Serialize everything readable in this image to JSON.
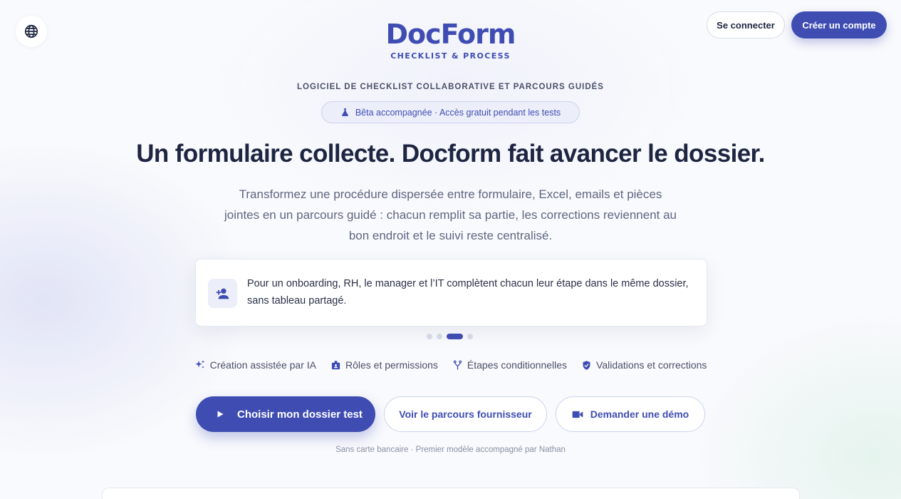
{
  "header": {
    "logo": {
      "name": "DocForm",
      "tagline": "CHECKLIST & PROCESS"
    },
    "login_label": "Se connecter",
    "signup_label": "Créer un compte",
    "globe_icon": "globe-icon"
  },
  "hero": {
    "eyebrow": "LOGICIEL DE CHECKLIST COLLABORATIVE ET PARCOURS GUIDÉS",
    "badge": {
      "icon": "flask-icon",
      "text": "Bêta accompagnée · Accès gratuit pendant les tests"
    },
    "headline": "Un formulaire collecte. Docform fait avancer le dossier.",
    "lead": "Transformez une procédure dispersée entre formulaire, Excel, emails et pièces jointes en un parcours guidé : chacun remplit sa partie, les corrections reviennent au bon endroit et le suivi reste centralisé."
  },
  "carousel": {
    "current_slide": {
      "icon": "person-add-icon",
      "text": "Pour un onboarding, RH, le manager et l’IT complètent chacun leur étape dans le même dossier, sans tableau partagé."
    },
    "slide_count": 4,
    "active_index": 2
  },
  "features": [
    {
      "icon": "sparkle-icon",
      "label": "Création assistée par IA"
    },
    {
      "icon": "badge-icon",
      "label": "Rôles et permissions"
    },
    {
      "icon": "fork-icon",
      "label": "Étapes conditionnelles"
    },
    {
      "icon": "shield-check-icon",
      "label": "Validations et corrections"
    }
  ],
  "cta": {
    "primary": {
      "icon": "play-icon",
      "label": "Choisir mon dossier test"
    },
    "secondary": {
      "label": "Voir le parcours fournisseur"
    },
    "demo": {
      "icon": "video-icon",
      "label": "Demander une démo"
    }
  },
  "reassurance": "Sans carte bancaire · Premier modèle accompagné par Nathan",
  "colors": {
    "brand": "#3f4db3",
    "text_dark": "#1d2541",
    "text_muted": "#5f6680"
  }
}
